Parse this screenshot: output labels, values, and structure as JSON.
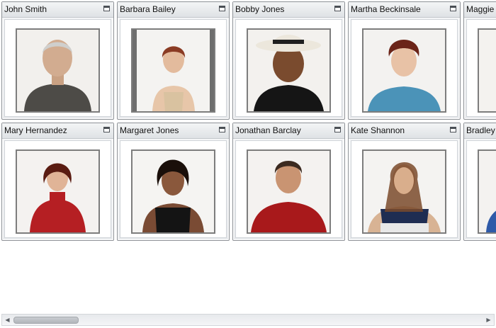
{
  "tiles": [
    {
      "name": "John Smith"
    },
    {
      "name": "Barbara Bailey"
    },
    {
      "name": "Bobby Jones"
    },
    {
      "name": "Martha Beckinsale"
    },
    {
      "name": "Maggie"
    },
    {
      "name": "Mary Hernandez"
    },
    {
      "name": "Margaret Jones"
    },
    {
      "name": "Jonathan Barclay"
    },
    {
      "name": "Kate Shannon"
    },
    {
      "name": "Bradley"
    }
  ],
  "scrollbar": {
    "left_arrow": "◀",
    "right_arrow": "▶"
  }
}
